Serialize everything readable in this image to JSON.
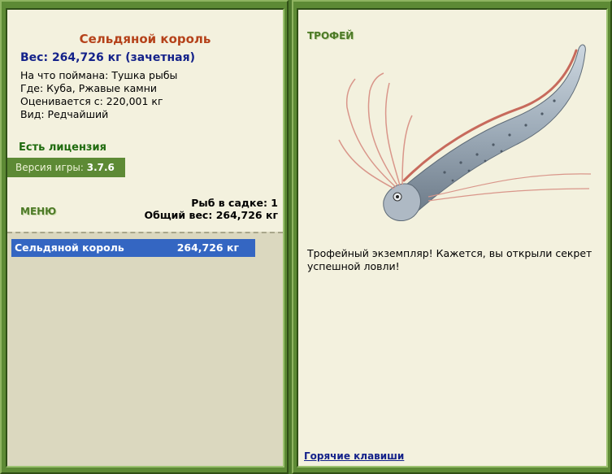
{
  "left": {
    "fish_name": "Сельдяной король",
    "weight_line": "Вес: 264,726 кг (зачетная)",
    "info": [
      "На что поймана: Тушка рыбы",
      "Где: Куба, Ржавые камни",
      "Оценивается с: 220,001 кг",
      "Вид: Редчайший"
    ],
    "license": "Есть лицензия",
    "version_label": "Версия игры:",
    "version_value": "3.7.6",
    "menu_label": "МЕНЮ",
    "fish_in_cage": "Рыб в садке: 1",
    "total_weight": "Общий вес: 264,726 кг",
    "catch_list": [
      {
        "name": "Сельдяной король",
        "weight": "264,726 кг"
      }
    ]
  },
  "right": {
    "trophy_label": "ТРОФЕЙ",
    "trophy_text": "Трофейный экземпляр! Кажется, вы открыли секрет успешной ловли!",
    "hotkeys": "Горячие клавиши"
  },
  "colors": {
    "frame_green": "#5d8a35",
    "panel_bg": "#f3f1de",
    "title_orange": "#b5421a",
    "weight_blue": "#14228a",
    "selection_blue": "#3466c2"
  }
}
